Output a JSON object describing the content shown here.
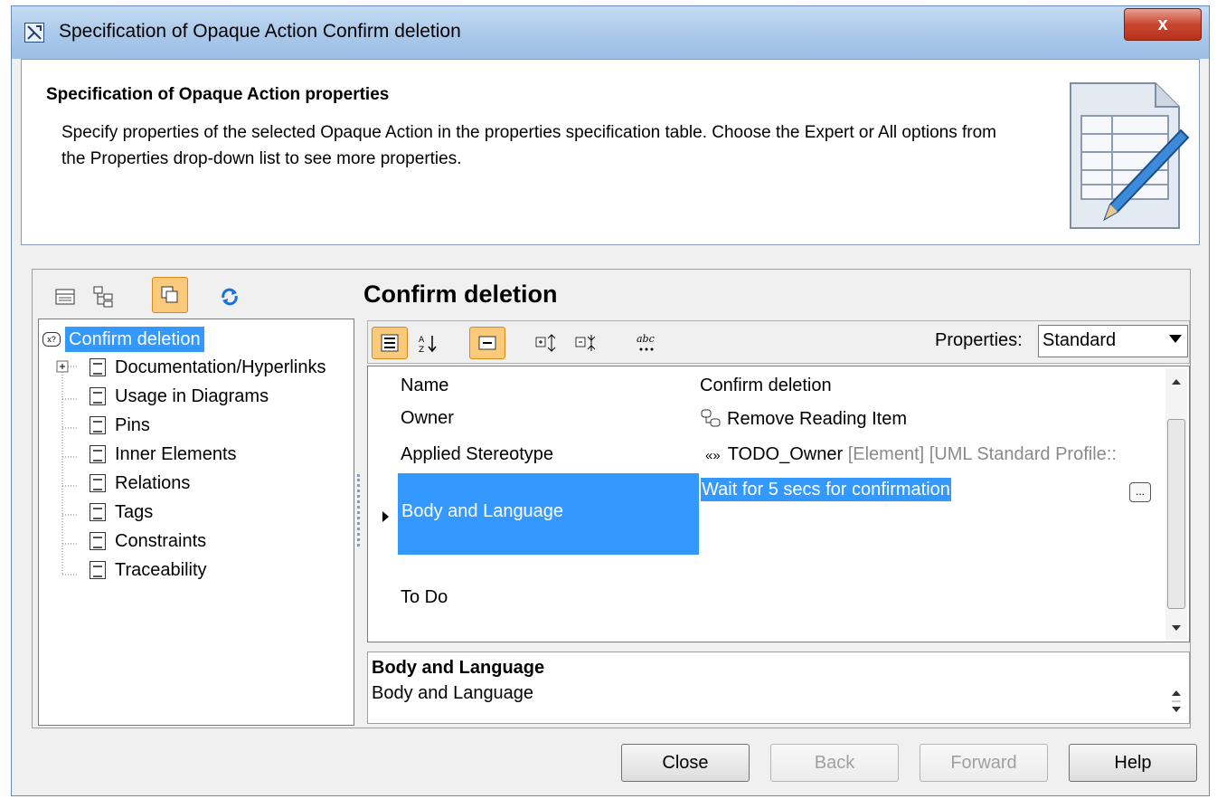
{
  "window": {
    "title": "Specification of Opaque Action Confirm deletion",
    "close_glyph": "x"
  },
  "header": {
    "title": "Specification of Opaque Action properties",
    "description": "Specify properties of the selected Opaque Action in the properties specification table. Choose the Expert or All options from the Properties drop-down list to see more properties."
  },
  "left_toolbar": {
    "icons": [
      "table-view-icon",
      "tree-view-icon",
      "copy-icon",
      "refresh-icon"
    ]
  },
  "tree": {
    "root": "Confirm deletion",
    "items": [
      "Documentation/Hyperlinks",
      "Usage in Diagrams",
      "Pins",
      "Inner Elements",
      "Relations",
      "Tags",
      "Constraints",
      "Traceability"
    ]
  },
  "right": {
    "title": "Confirm deletion",
    "properties_label": "Properties:",
    "properties_value": "Standard"
  },
  "grid": {
    "rows": [
      {
        "name": "Name",
        "value": "Confirm deletion"
      },
      {
        "name": "Owner",
        "value": "Remove Reading Item"
      },
      {
        "name": "Applied Stereotype",
        "value": "TODO_Owner",
        "value_suffix": "[Element] [UML Standard Profile::"
      },
      {
        "name": "Body and Language",
        "value": "Wait for 5 secs for confirmation",
        "ellipsis": "..."
      },
      {
        "name": "To Do",
        "value": ""
      }
    ]
  },
  "description_panel": {
    "title": "Body and Language",
    "text": "Body and Language"
  },
  "buttons": {
    "close": "Close",
    "back": "Back",
    "forward": "Forward",
    "help": "Help"
  },
  "colors": {
    "selection": "#3399ff",
    "active_tool": "#fbc97a",
    "title_bar": "#a9c8ea"
  }
}
